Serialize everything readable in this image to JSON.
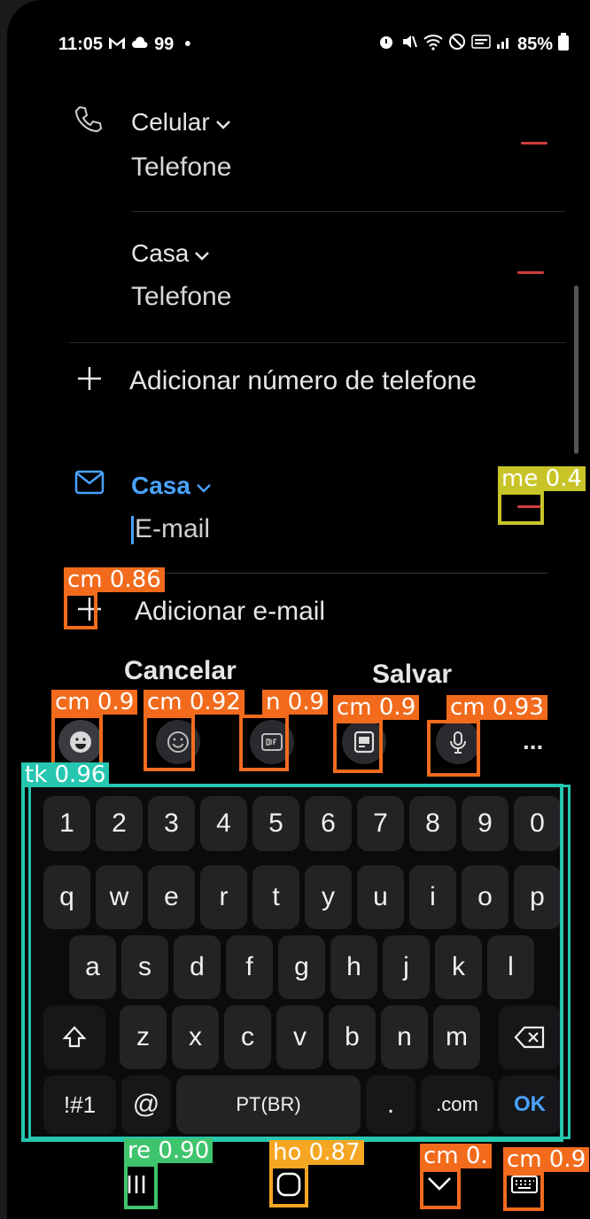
{
  "status_bar": {
    "time": "11:05",
    "notif": "99",
    "dot": "•",
    "battery": "85%"
  },
  "phone_rows": [
    {
      "label": "Celular",
      "value": "Telefone"
    },
    {
      "label": "Casa",
      "value": "Telefone"
    }
  ],
  "add_phone": "Adicionar número de telefone",
  "email": {
    "label": "Casa",
    "placeholder": "E-mail"
  },
  "add_email": "Adicionar e-mail",
  "actions": {
    "cancel": "Cancelar",
    "save": "Salvar"
  },
  "toolbar": {
    "more": "..."
  },
  "keyboard": {
    "row_numbers": [
      "1",
      "2",
      "3",
      "4",
      "5",
      "6",
      "7",
      "8",
      "9",
      "0"
    ],
    "row_q": [
      "q",
      "w",
      "e",
      "r",
      "t",
      "y",
      "u",
      "i",
      "o",
      "p"
    ],
    "row_a": [
      "a",
      "s",
      "d",
      "f",
      "g",
      "h",
      "j",
      "k",
      "l"
    ],
    "row_z": [
      "z",
      "x",
      "c",
      "v",
      "b",
      "n",
      "m"
    ],
    "symbols": "!#1",
    "at": "@",
    "space": "PT(BR)",
    "period": ".",
    "dotcom": ".com",
    "ok": "OK"
  },
  "detections": [
    {
      "label": "me 0.4",
      "color": "#c8c428"
    },
    {
      "label": "cm 0.86",
      "color": "#f26b1d"
    },
    {
      "label": "cm 0.9",
      "color": "#f26b1d"
    },
    {
      "label": "cm 0.92",
      "color": "#f26b1d"
    },
    {
      "label": "n 0.9",
      "color": "#f26b1d"
    },
    {
      "label": "cm 0.9",
      "color": "#f26b1d"
    },
    {
      "label": "cm 0.93",
      "color": "#f26b1d"
    },
    {
      "label": "tk 0.96",
      "color": "#26c6b0"
    },
    {
      "label": "re 0.90",
      "color": "#3ec46d"
    },
    {
      "label": "ho 0.87",
      "color": "#f5a623"
    },
    {
      "label": "cm 0.",
      "color": "#f26b1d"
    },
    {
      "label": "cm 0.9",
      "color": "#f26b1d"
    }
  ]
}
